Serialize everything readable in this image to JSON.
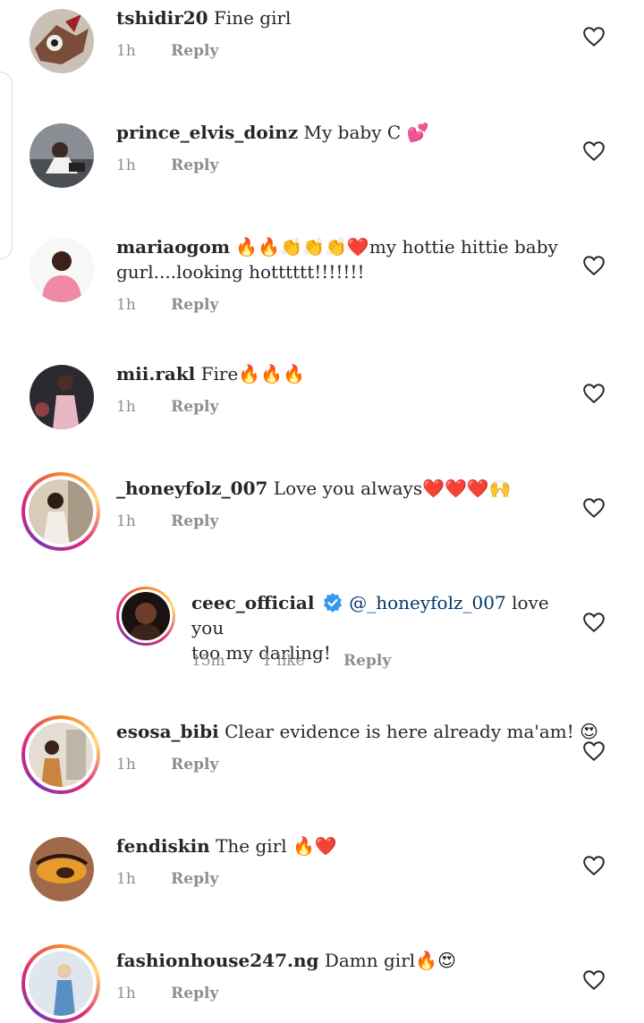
{
  "comments": [
    {
      "username": "tshidir20",
      "text": "Fine girl",
      "emoji": "",
      "time": "1h",
      "likes": "",
      "reply": "Reply"
    },
    {
      "username": "prince_elvis_doinz",
      "text": "My baby C",
      "emoji": "💕",
      "time": "1h",
      "likes": "",
      "reply": "Reply"
    },
    {
      "username": "mariaogom",
      "text_line1_emoji": "🔥🔥👏👏👏❤️",
      "text_line1": "my hottie hittie baby",
      "text_line2": "gurl....looking hotttttt!!!!!!!",
      "time": "1h",
      "likes": "",
      "reply": "Reply"
    },
    {
      "username": "mii.rakl",
      "text": "Fire",
      "emoji": "🔥🔥🔥",
      "time": "1h",
      "likes": "",
      "reply": "Reply"
    },
    {
      "username": "_honeyfolz_007",
      "text": "Love you always",
      "emoji": "❤️❤️❤️🙌",
      "time": "1h",
      "likes": "",
      "reply": "Reply"
    },
    {
      "username": "ceec_official",
      "mention": "@_honeyfolz_007",
      "text_line1": "love you",
      "text_line2": "too my darling!",
      "time": "15m",
      "likes": "1 like",
      "reply": "Reply",
      "verified": true
    },
    {
      "username": "esosa_bibi",
      "text": "Clear evidence is here already ma'am!",
      "emoji": "😍",
      "time": "1h",
      "likes": "",
      "reply": "Reply"
    },
    {
      "username": "fendiskin",
      "text": "The girl",
      "emoji": "🔥❤️",
      "time": "1h",
      "likes": "",
      "reply": "Reply"
    },
    {
      "username": "fashionhouse247.ng",
      "text": "Damn girl",
      "emoji": "🔥😍",
      "time": "1h",
      "likes": "",
      "reply": "Reply"
    }
  ],
  "colors": {
    "text": "#262626",
    "meta": "#8e8e8e",
    "mention": "#00376b",
    "verified": "#3897f0"
  },
  "icons": {
    "like": "heart-outline-icon",
    "verified": "verified-badge-icon"
  }
}
